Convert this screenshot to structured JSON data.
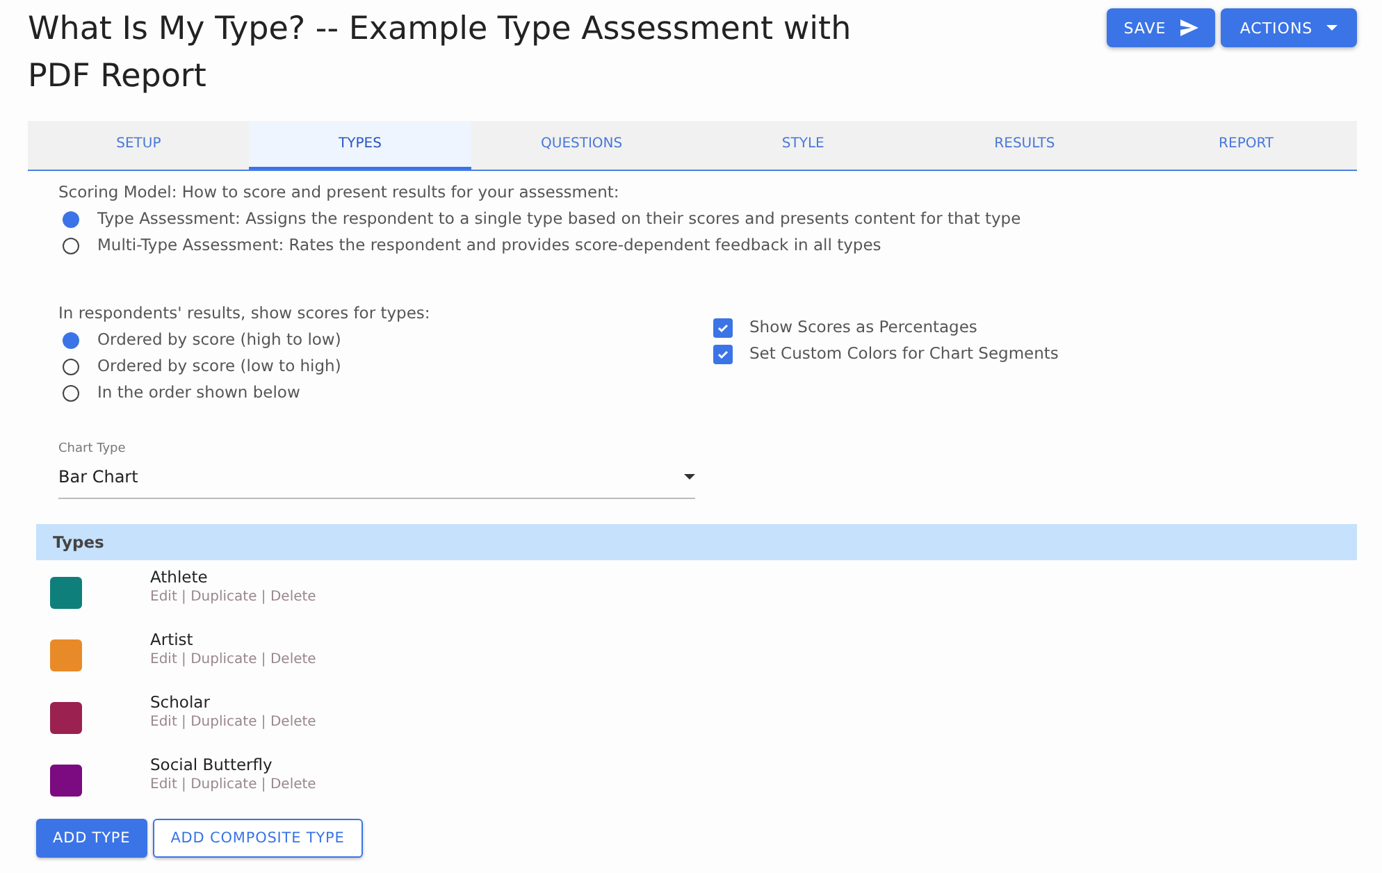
{
  "title": "What Is My Type? -- Example Type Assessment with PDF Report",
  "header_buttons": [
    {
      "label": "SAVE",
      "kind": "save"
    },
    {
      "label": "ACTIONS",
      "kind": "menu"
    }
  ],
  "tabs": [
    {
      "label": "SETUP",
      "selected": false
    },
    {
      "label": "TYPES",
      "selected": true
    },
    {
      "label": "QUESTIONS",
      "selected": false
    },
    {
      "label": "STYLE",
      "selected": false
    },
    {
      "label": "RESULTS",
      "selected": false
    },
    {
      "label": "REPORT",
      "selected": false
    }
  ],
  "scoring_model": {
    "label": "Scoring Model: How to score and present results for your assessment:",
    "options": [
      {
        "label": "Type Assessment: Assigns the respondent to a single type based on their scores and presents content for that type",
        "selected": true
      },
      {
        "label": "Multi-Type Assessment: Rates the respondent and provides score-dependent feedback in all types",
        "selected": false
      }
    ]
  },
  "score_order": {
    "label": "In respondents' results, show scores for types:",
    "options": [
      {
        "label": "Ordered by score (high to low)",
        "selected": true
      },
      {
        "label": "Ordered by score (low to high)",
        "selected": false
      },
      {
        "label": "In the order shown below",
        "selected": false
      }
    ]
  },
  "checkboxes": [
    {
      "label": "Show Scores as Percentages",
      "checked": true
    },
    {
      "label": "Set Custom Colors for Chart Segments",
      "checked": true
    }
  ],
  "chart_type": {
    "label": "Chart Type",
    "value": "Bar Chart"
  },
  "types_header": "Types",
  "types": [
    {
      "name": "Athlete",
      "color": "#0f7f7c",
      "actions": "Edit | Duplicate | Delete"
    },
    {
      "name": "Artist",
      "color": "#e88a28",
      "actions": "Edit | Duplicate | Delete"
    },
    {
      "name": "Scholar",
      "color": "#9b2150",
      "actions": "Edit | Duplicate | Delete"
    },
    {
      "name": "Social Butterfly",
      "color": "#7c0a80",
      "actions": "Edit | Duplicate | Delete"
    }
  ],
  "footer_buttons": [
    {
      "label": "ADD TYPE",
      "kind": "primary"
    },
    {
      "label": "ADD COMPOSITE TYPE",
      "kind": "outline"
    }
  ]
}
